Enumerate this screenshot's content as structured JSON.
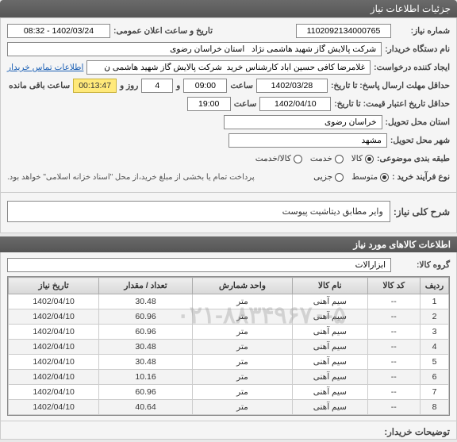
{
  "header": {
    "title": "جزئیات اطلاعات نیاز"
  },
  "form": {
    "need_no_label": "شماره نیاز:",
    "need_no": "1102092134000765",
    "public_date_label": "تاریخ و ساعت اعلان عمومی:",
    "public_date": "1402/03/24 - 08:32",
    "buyer_label": "نام دستگاه خریدار:",
    "buyer": "شرکت پالایش گاز شهید هاشمی نژاد   استان خراسان رضوی",
    "creator_label": "ایجاد کننده درخواست:",
    "creator": "غلامرضا کافی حسین آباد کارشناس خرید  شرکت پالایش گاز شهید هاشمی ن",
    "contact_link": "اطلاعات تماس خریدار",
    "deadline_label": "حداقل مهلت ارسال پاسخ: تا تاریخ:",
    "deadline_date": "1402/03/28",
    "time_label": "ساعت",
    "deadline_time": "09:00",
    "and_label": "و",
    "days": "4",
    "days_label": "روز و",
    "timer": "00:13:47",
    "timer_label": "ساعت باقی مانده",
    "validity_label": "حداقل تاریخ اعتبار قیمت: تا تاریخ:",
    "validity_date": "1402/04/10",
    "validity_time": "19:00",
    "province_label": "استان محل تحویل:",
    "province": "خراسان رضوی",
    "city_label": "شهر محل تحویل:",
    "city": "مشهد",
    "subject_class_label": "طبقه بندی موضوعی:",
    "goods_service_opt": "کالا/خدمت",
    "service_opt": "خدمت",
    "goods_opt": "کالا",
    "purchase_type_label": "نوع فرآیند خرید :",
    "medium_opt": "متوسط",
    "small_opt": "جزیی",
    "purchase_note": "پرداخت تمام یا بخشی از مبلغ خرید،از محل \"اسناد خزانه اسلامی\" خواهد بود.",
    "ns_label": "؟"
  },
  "desc": {
    "label": "شرح کلی نیاز:",
    "text": "وایر مطابق دیتاشیت پیوست"
  },
  "goods_section": {
    "title": "اطلاعات کالاهای مورد نیاز",
    "group_label": "گروه کالا:",
    "group": "ابزارآلات"
  },
  "table": {
    "headers": [
      "ردیف",
      "کد کالا",
      "نام کالا",
      "واحد شمارش",
      "تعداد / مقدار",
      "تاریخ نیاز"
    ],
    "rows": [
      {
        "idx": "1",
        "code": "--",
        "name": "سیم آهنی",
        "unit": "متر",
        "qty": "30.48",
        "date": "1402/04/10"
      },
      {
        "idx": "2",
        "code": "--",
        "name": "سیم آهنی",
        "unit": "متر",
        "qty": "60.96",
        "date": "1402/04/10"
      },
      {
        "idx": "3",
        "code": "--",
        "name": "سیم آهنی",
        "unit": "متر",
        "qty": "60.96",
        "date": "1402/04/10"
      },
      {
        "idx": "4",
        "code": "--",
        "name": "سیم آهنی",
        "unit": "متر",
        "qty": "30.48",
        "date": "1402/04/10"
      },
      {
        "idx": "5",
        "code": "--",
        "name": "سیم آهنی",
        "unit": "متر",
        "qty": "30.48",
        "date": "1402/04/10"
      },
      {
        "idx": "6",
        "code": "--",
        "name": "سیم آهنی",
        "unit": "متر",
        "qty": "10.16",
        "date": "1402/04/10"
      },
      {
        "idx": "7",
        "code": "--",
        "name": "سیم آهنی",
        "unit": "متر",
        "qty": "60.96",
        "date": "1402/04/10"
      },
      {
        "idx": "8",
        "code": "--",
        "name": "سیم آهنی",
        "unit": "متر",
        "qty": "40.64",
        "date": "1402/04/10"
      }
    ]
  },
  "footer": {
    "buyer_notes_label": "توضیحات خریدار:"
  },
  "watermark": "۰۲۱-۸۸۳۴۹۶۷۰-۵"
}
